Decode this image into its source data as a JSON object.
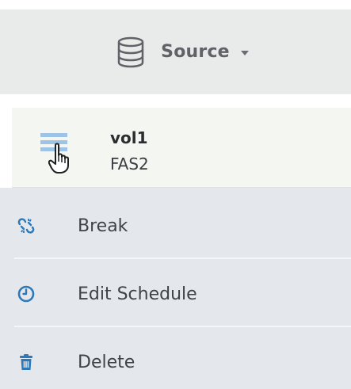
{
  "header": {
    "label": "Source",
    "icon": "database-icon",
    "dropdown_icon": "caret-down-icon"
  },
  "row": {
    "title": "vol1",
    "subtitle": "FAS2",
    "icon": "list-lines-icon",
    "cursor": "hand-pointer-icon"
  },
  "menu": {
    "items": [
      {
        "label": "Break",
        "icon": "broken-link-icon"
      },
      {
        "label": "Edit Schedule",
        "icon": "clock-icon"
      },
      {
        "label": "Delete",
        "icon": "trash-icon"
      }
    ]
  },
  "colors": {
    "header_bg": "#e9ebea",
    "row_bg": "#f3f6f1",
    "menu_bg": "#e4e8ec",
    "accent_blue": "#2d78b8",
    "icon_light_blue": "#9dc3e6"
  }
}
